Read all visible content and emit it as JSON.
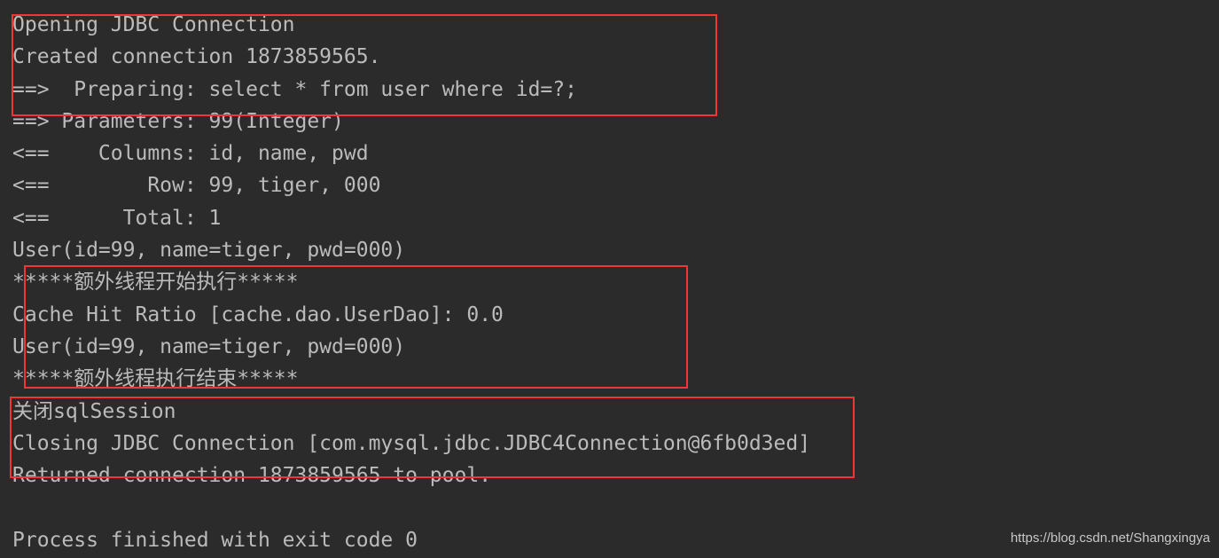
{
  "console": {
    "lines": [
      "Opening JDBC Connection",
      "Created connection 1873859565.",
      "==>  Preparing: select * from user where id=?;",
      "==> Parameters: 99(Integer)",
      "<==    Columns: id, name, pwd",
      "<==        Row: 99, tiger, 000",
      "<==      Total: 1",
      "User(id=99, name=tiger, pwd=000)",
      "*****额外线程开始执行*****",
      "Cache Hit Ratio [cache.dao.UserDao]: 0.0",
      "User(id=99, name=tiger, pwd=000)",
      "*****额外线程执行结束*****",
      "关闭sqlSession",
      "Closing JDBC Connection [com.mysql.jdbc.JDBC4Connection@6fb0d3ed]",
      "Returned connection 1873859565 to pool.",
      "",
      "Process finished with exit code 0"
    ]
  },
  "highlight_color": "#f23535",
  "watermark": "https://blog.csdn.net/Shangxingya"
}
